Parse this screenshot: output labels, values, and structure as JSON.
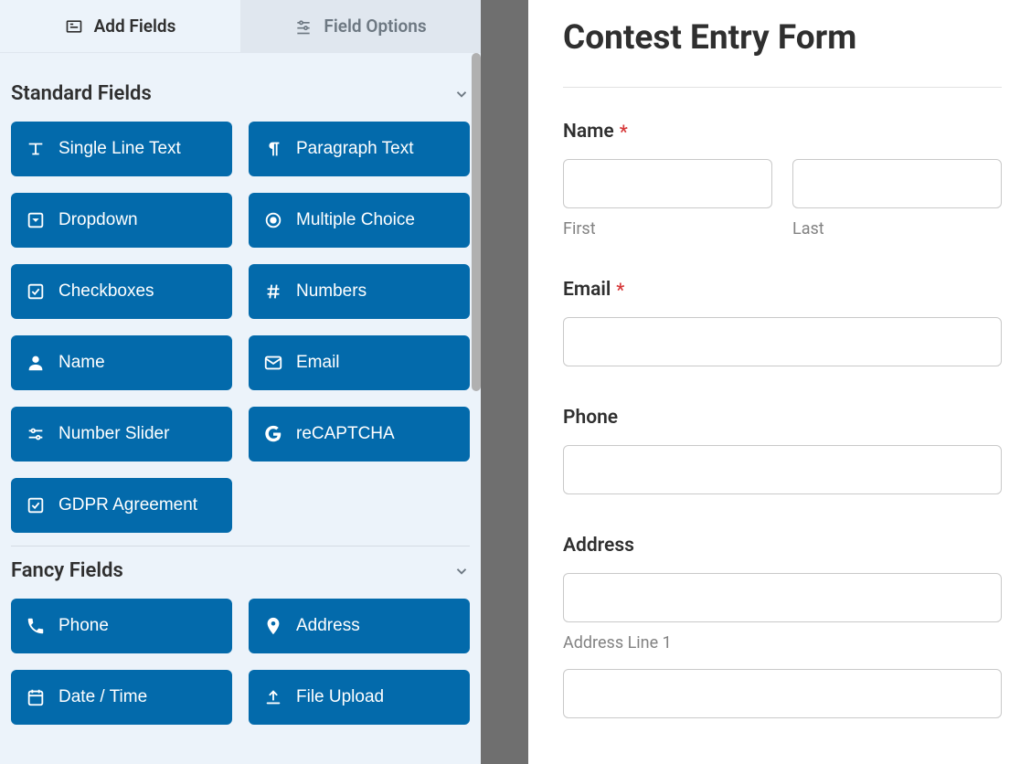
{
  "tabs": {
    "add_fields": "Add Fields",
    "field_options": "Field Options"
  },
  "sections": {
    "standard": {
      "title": "Standard Fields",
      "fields": [
        "Single Line Text",
        "Paragraph Text",
        "Dropdown",
        "Multiple Choice",
        "Checkboxes",
        "Numbers",
        "Name",
        "Email",
        "Number Slider",
        "reCAPTCHA",
        "GDPR Agreement"
      ]
    },
    "fancy": {
      "title": "Fancy Fields",
      "fields": [
        "Phone",
        "Address",
        "Date / Time",
        "File Upload"
      ]
    }
  },
  "form": {
    "title": "Contest Entry Form",
    "name": {
      "label": "Name",
      "first": "First",
      "last": "Last",
      "required": true
    },
    "email": {
      "label": "Email",
      "required": true
    },
    "phone": {
      "label": "Phone",
      "required": false
    },
    "address": {
      "label": "Address",
      "line1": "Address Line 1",
      "required": false
    }
  },
  "colors": {
    "accent": "#036aab"
  }
}
